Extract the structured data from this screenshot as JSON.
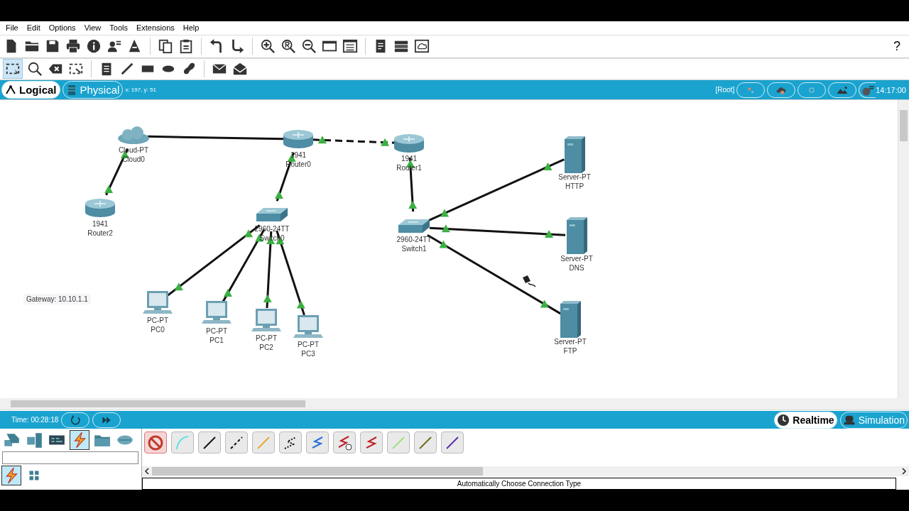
{
  "menu": [
    "File",
    "Edit",
    "Options",
    "View",
    "Tools",
    "Extensions",
    "Help"
  ],
  "help": "?",
  "workspace_tabs": [
    {
      "label": "Logical",
      "selected": true
    },
    {
      "label": "Physical",
      "selected": false
    }
  ],
  "coordinates": "x: 197, y: 51",
  "root_label": "[Root]",
  "clock": "14:17:00",
  "nodes": [
    {
      "kind": "cloud",
      "model": "Cloud-PT",
      "name": "Cloud0"
    },
    {
      "kind": "router",
      "model": "1941",
      "name": "Router0"
    },
    {
      "kind": "router",
      "model": "1941",
      "name": "Router1"
    },
    {
      "kind": "router",
      "model": "1941",
      "name": "Router2"
    },
    {
      "kind": "switch",
      "model": "2960-24TT",
      "name": "Switch0"
    },
    {
      "kind": "switch",
      "model": "2960-24TT",
      "name": "Switch1"
    },
    {
      "kind": "pc",
      "model": "PC-PT",
      "name": "PC0"
    },
    {
      "kind": "pc",
      "model": "PC-PT",
      "name": "PC1"
    },
    {
      "kind": "pc",
      "model": "PC-PT",
      "name": "PC2"
    },
    {
      "kind": "pc",
      "model": "PC-PT",
      "name": "PC3"
    },
    {
      "kind": "server",
      "model": "Server-PT",
      "name": "HTTP"
    },
    {
      "kind": "server",
      "model": "Server-PT",
      "name": "DNS"
    },
    {
      "kind": "server",
      "model": "Server-PT",
      "name": "FTP"
    }
  ],
  "links": [
    {
      "kind": "straight",
      "up": false
    },
    {
      "kind": "crossover",
      "up": true
    },
    {
      "kind": "straight",
      "up": true
    },
    {
      "kind": "straight",
      "up": true
    },
    {
      "kind": "straight",
      "up": true
    },
    {
      "kind": "straight",
      "up": true
    },
    {
      "kind": "straight",
      "up": true
    },
    {
      "kind": "straight",
      "up": true
    },
    {
      "kind": "straight",
      "up": true
    },
    {
      "kind": "straight",
      "up": true
    },
    {
      "kind": "straight",
      "up": true
    },
    {
      "kind": "straight",
      "up": true
    }
  ],
  "note": "Gateway: 10.10.1.1",
  "time": "Time: 00:28:18",
  "modes": [
    {
      "label": "Realtime",
      "selected": true
    },
    {
      "label": "Simulation",
      "selected": false
    }
  ],
  "device_categories": [
    {
      "selected": false
    },
    {
      "selected": false
    },
    {
      "selected": false
    },
    {
      "selected": true
    },
    {
      "selected": false
    },
    {
      "selected": false
    }
  ],
  "device_subtypes": [
    {
      "selected": true
    },
    {
      "selected": false
    }
  ],
  "status": "Automatically Choose Connection Type"
}
